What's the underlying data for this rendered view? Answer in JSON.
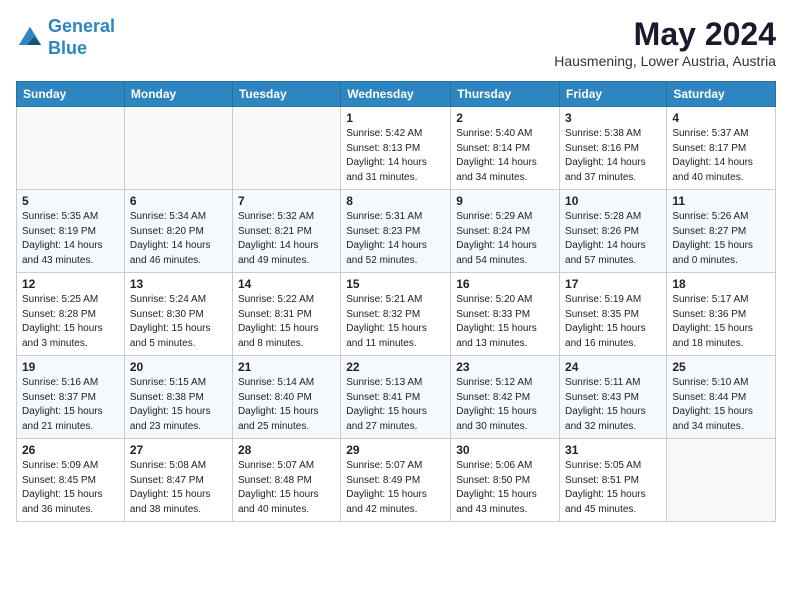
{
  "header": {
    "logo_line1": "General",
    "logo_line2": "Blue",
    "month": "May 2024",
    "location": "Hausmening, Lower Austria, Austria"
  },
  "weekdays": [
    "Sunday",
    "Monday",
    "Tuesday",
    "Wednesday",
    "Thursday",
    "Friday",
    "Saturday"
  ],
  "weeks": [
    [
      {
        "day": "",
        "content": ""
      },
      {
        "day": "",
        "content": ""
      },
      {
        "day": "",
        "content": ""
      },
      {
        "day": "1",
        "content": "Sunrise: 5:42 AM\nSunset: 8:13 PM\nDaylight: 14 hours\nand 31 minutes."
      },
      {
        "day": "2",
        "content": "Sunrise: 5:40 AM\nSunset: 8:14 PM\nDaylight: 14 hours\nand 34 minutes."
      },
      {
        "day": "3",
        "content": "Sunrise: 5:38 AM\nSunset: 8:16 PM\nDaylight: 14 hours\nand 37 minutes."
      },
      {
        "day": "4",
        "content": "Sunrise: 5:37 AM\nSunset: 8:17 PM\nDaylight: 14 hours\nand 40 minutes."
      }
    ],
    [
      {
        "day": "5",
        "content": "Sunrise: 5:35 AM\nSunset: 8:19 PM\nDaylight: 14 hours\nand 43 minutes."
      },
      {
        "day": "6",
        "content": "Sunrise: 5:34 AM\nSunset: 8:20 PM\nDaylight: 14 hours\nand 46 minutes."
      },
      {
        "day": "7",
        "content": "Sunrise: 5:32 AM\nSunset: 8:21 PM\nDaylight: 14 hours\nand 49 minutes."
      },
      {
        "day": "8",
        "content": "Sunrise: 5:31 AM\nSunset: 8:23 PM\nDaylight: 14 hours\nand 52 minutes."
      },
      {
        "day": "9",
        "content": "Sunrise: 5:29 AM\nSunset: 8:24 PM\nDaylight: 14 hours\nand 54 minutes."
      },
      {
        "day": "10",
        "content": "Sunrise: 5:28 AM\nSunset: 8:26 PM\nDaylight: 14 hours\nand 57 minutes."
      },
      {
        "day": "11",
        "content": "Sunrise: 5:26 AM\nSunset: 8:27 PM\nDaylight: 15 hours\nand 0 minutes."
      }
    ],
    [
      {
        "day": "12",
        "content": "Sunrise: 5:25 AM\nSunset: 8:28 PM\nDaylight: 15 hours\nand 3 minutes."
      },
      {
        "day": "13",
        "content": "Sunrise: 5:24 AM\nSunset: 8:30 PM\nDaylight: 15 hours\nand 5 minutes."
      },
      {
        "day": "14",
        "content": "Sunrise: 5:22 AM\nSunset: 8:31 PM\nDaylight: 15 hours\nand 8 minutes."
      },
      {
        "day": "15",
        "content": "Sunrise: 5:21 AM\nSunset: 8:32 PM\nDaylight: 15 hours\nand 11 minutes."
      },
      {
        "day": "16",
        "content": "Sunrise: 5:20 AM\nSunset: 8:33 PM\nDaylight: 15 hours\nand 13 minutes."
      },
      {
        "day": "17",
        "content": "Sunrise: 5:19 AM\nSunset: 8:35 PM\nDaylight: 15 hours\nand 16 minutes."
      },
      {
        "day": "18",
        "content": "Sunrise: 5:17 AM\nSunset: 8:36 PM\nDaylight: 15 hours\nand 18 minutes."
      }
    ],
    [
      {
        "day": "19",
        "content": "Sunrise: 5:16 AM\nSunset: 8:37 PM\nDaylight: 15 hours\nand 21 minutes."
      },
      {
        "day": "20",
        "content": "Sunrise: 5:15 AM\nSunset: 8:38 PM\nDaylight: 15 hours\nand 23 minutes."
      },
      {
        "day": "21",
        "content": "Sunrise: 5:14 AM\nSunset: 8:40 PM\nDaylight: 15 hours\nand 25 minutes."
      },
      {
        "day": "22",
        "content": "Sunrise: 5:13 AM\nSunset: 8:41 PM\nDaylight: 15 hours\nand 27 minutes."
      },
      {
        "day": "23",
        "content": "Sunrise: 5:12 AM\nSunset: 8:42 PM\nDaylight: 15 hours\nand 30 minutes."
      },
      {
        "day": "24",
        "content": "Sunrise: 5:11 AM\nSunset: 8:43 PM\nDaylight: 15 hours\nand 32 minutes."
      },
      {
        "day": "25",
        "content": "Sunrise: 5:10 AM\nSunset: 8:44 PM\nDaylight: 15 hours\nand 34 minutes."
      }
    ],
    [
      {
        "day": "26",
        "content": "Sunrise: 5:09 AM\nSunset: 8:45 PM\nDaylight: 15 hours\nand 36 minutes."
      },
      {
        "day": "27",
        "content": "Sunrise: 5:08 AM\nSunset: 8:47 PM\nDaylight: 15 hours\nand 38 minutes."
      },
      {
        "day": "28",
        "content": "Sunrise: 5:07 AM\nSunset: 8:48 PM\nDaylight: 15 hours\nand 40 minutes."
      },
      {
        "day": "29",
        "content": "Sunrise: 5:07 AM\nSunset: 8:49 PM\nDaylight: 15 hours\nand 42 minutes."
      },
      {
        "day": "30",
        "content": "Sunrise: 5:06 AM\nSunset: 8:50 PM\nDaylight: 15 hours\nand 43 minutes."
      },
      {
        "day": "31",
        "content": "Sunrise: 5:05 AM\nSunset: 8:51 PM\nDaylight: 15 hours\nand 45 minutes."
      },
      {
        "day": "",
        "content": ""
      }
    ]
  ]
}
